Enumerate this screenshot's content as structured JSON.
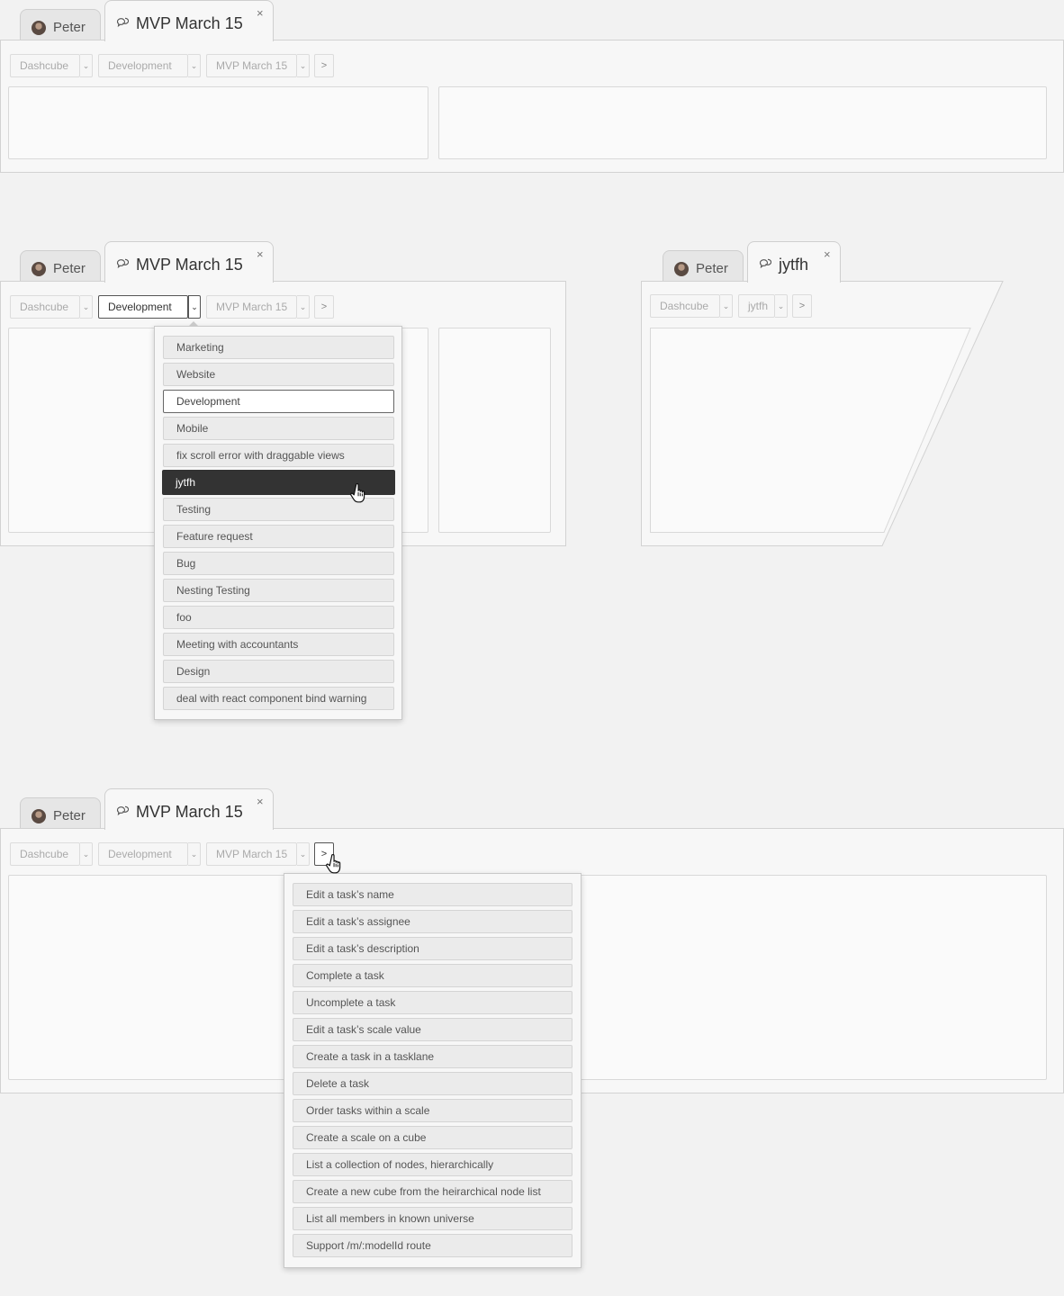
{
  "scene1": {
    "tabs": {
      "user_tab": "Peter",
      "active_tab": "MVP March 15",
      "close": "×"
    },
    "breadcrumb": {
      "crumb1": "Dashcube",
      "crumb2": "Development",
      "crumb3": "MVP March 15",
      "caret": "⌄",
      "next": ">"
    }
  },
  "scene2": {
    "tabs": {
      "user_tab": "Peter",
      "active_tab": "MVP March 15",
      "close": "×"
    },
    "breadcrumb": {
      "crumb1": "Dashcube",
      "crumb2": "Development",
      "crumb3": "MVP March 15",
      "caret": "⌄",
      "next": ">"
    },
    "dropdown_items": [
      "Marketing",
      "Website",
      "Development",
      "Mobile",
      "fix scroll error with draggable views",
      "jytfh",
      "Testing",
      "Feature request",
      "Bug",
      "Nesting Testing",
      "foo",
      "Meeting with accountants",
      "Design",
      "deal with react component bind warning"
    ],
    "selected_item": "Development",
    "hovered_item": "jytfh"
  },
  "scene3": {
    "tabs": {
      "user_tab": "Peter",
      "active_tab": "jytfh",
      "close": "×"
    },
    "breadcrumb": {
      "crumb1": "Dashcube",
      "crumb2": "jytfh",
      "caret": "⌄",
      "next": ">"
    }
  },
  "scene4": {
    "tabs": {
      "user_tab": "Peter",
      "active_tab": "MVP March 15",
      "close": "×"
    },
    "breadcrumb": {
      "crumb1": "Dashcube",
      "crumb2": "Development",
      "crumb3": "MVP March 15",
      "caret": "⌄",
      "next": ">"
    },
    "dropdown_items": [
      "Edit a task’s name",
      "Edit a task’s assignee",
      "Edit a task’s description",
      "Complete a task",
      "Uncomplete a task",
      "Edit a task’s scale value",
      "Create a task in a tasklane",
      "Delete a task",
      "Order tasks within a scale",
      "Create a scale on a cube",
      "List a collection of nodes, hierarchically",
      "Create a new cube from the heirarchical node list",
      "List all members in known universe",
      "Support /m/:modelId route"
    ]
  },
  "icons": {
    "avatar": "user-avatar-icon",
    "chat": "chat-bubbles-icon",
    "cursor": "hand-pointer-icon"
  },
  "colors": {
    "background": "#f2f2f2",
    "panel": "#f7f7f7",
    "border": "#d2d2d2",
    "hover": "#333333",
    "menu_item": "#ebebeb"
  }
}
